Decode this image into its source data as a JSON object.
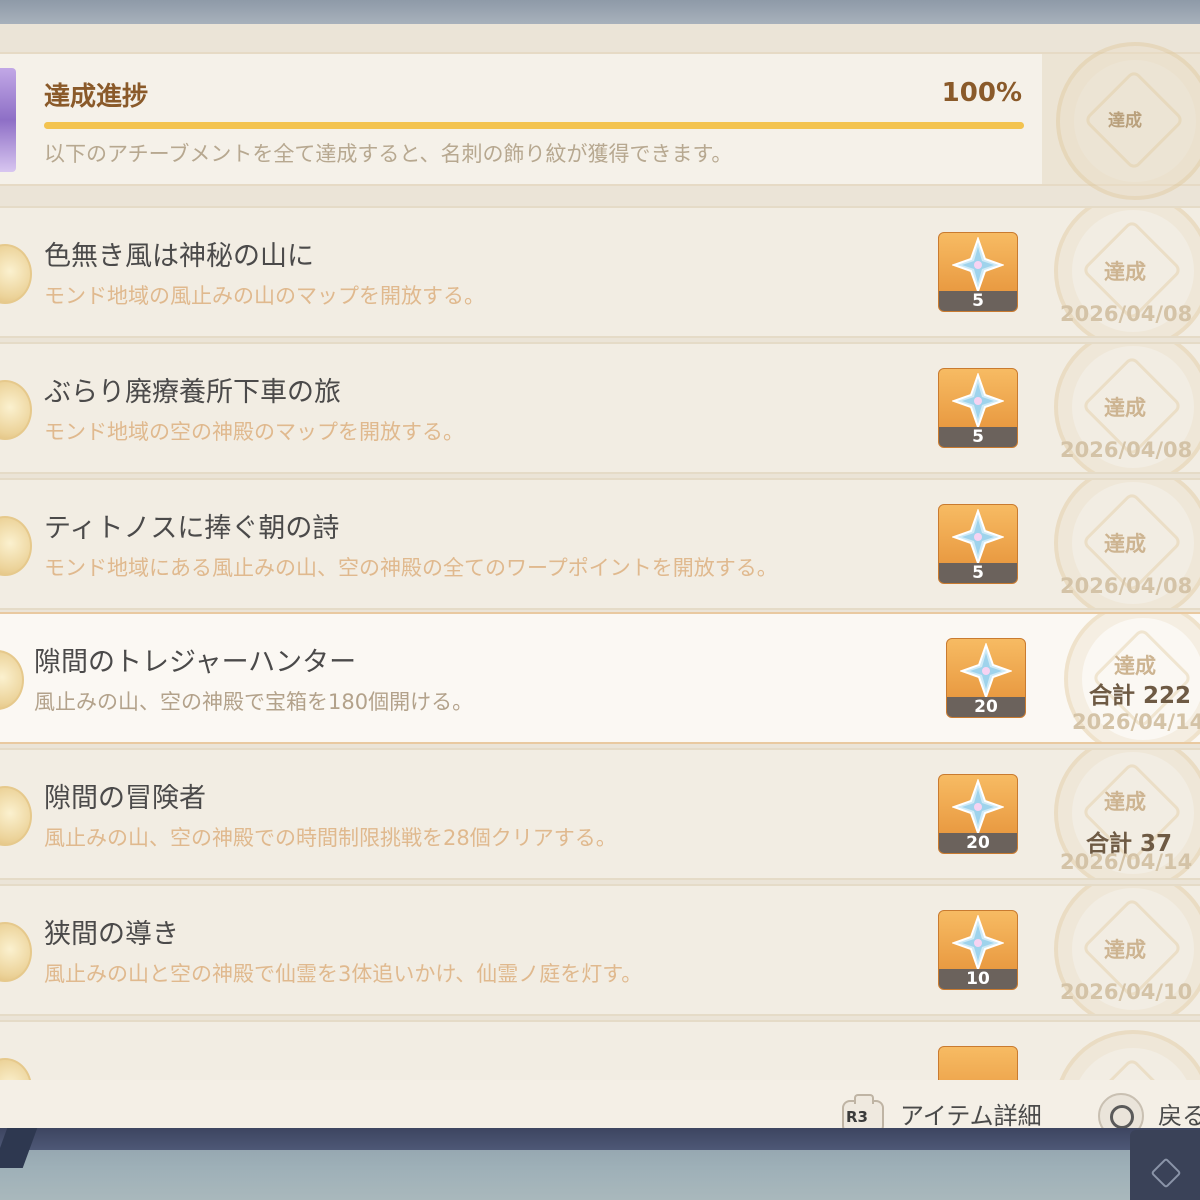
{
  "header": {
    "title": "達成進捗",
    "percent_text": "100%",
    "progress": 1.0,
    "description": "以下のアチーブメントを全て達成すると、名刺の飾り紋が獲得できます。",
    "status": "達成"
  },
  "achievements": [
    {
      "title": "色無き風は神秘の山に",
      "description": "モンド地域の風止みの山のマップを開放する。",
      "reward_qty": "5",
      "status": "達成",
      "date": "2026/04/08"
    },
    {
      "title": "ぶらり廃療養所下車の旅",
      "description": "モンド地域の空の神殿のマップを開放する。",
      "reward_qty": "5",
      "status": "達成",
      "date": "2026/04/08"
    },
    {
      "title": "ティトノスに捧ぐ朝の詩",
      "description": "モンド地域にある風止みの山、空の神殿の全てのワープポイントを開放する。",
      "reward_qty": "5",
      "status": "達成",
      "date": "2026/04/08"
    },
    {
      "title": "隙間のトレジャーハンター",
      "description": "風止みの山、空の神殿で宝箱を180個開ける。",
      "reward_qty": "20",
      "status": "達成",
      "total": "合計 222",
      "date": "2026/04/14"
    },
    {
      "title": "隙間の冒険者",
      "description": "風止みの山、空の神殿での時間制限挑戦を28個クリアする。",
      "reward_qty": "20",
      "status": "達成",
      "total": "合計 37",
      "date": "2026/04/14"
    },
    {
      "title": "狭間の導き",
      "description": "風止みの山と空の神殿で仙霊を3体追いかけ、仙霊ノ庭を灯す。",
      "reward_qty": "10",
      "status": "達成",
      "date": "2026/04/10"
    }
  ],
  "footer": {
    "r3_label": "R3",
    "item_detail": "アイテム詳細",
    "back": "戻る"
  },
  "colors": {
    "accent_brown": "#8a5a2a",
    "progress_yellow": "#f3c34f",
    "reward_orange": "#e48f36",
    "description_orange": "#e0b98e"
  }
}
